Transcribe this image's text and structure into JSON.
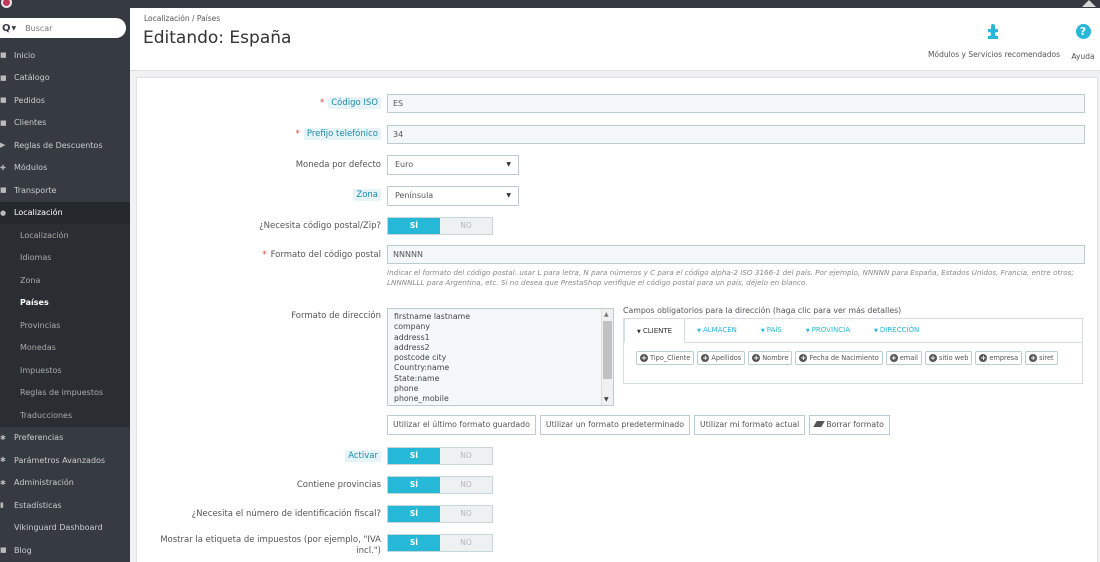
{
  "search": {
    "placeholder": "Buscar"
  },
  "sidebar": {
    "items": [
      {
        "label": "Inicio",
        "icon": "home-icon"
      },
      {
        "label": "Catálogo",
        "icon": "catalog-icon"
      },
      {
        "label": "Pedidos",
        "icon": "orders-icon"
      },
      {
        "label": "Clientes",
        "icon": "customers-icon"
      },
      {
        "label": "Reglas de Descuentos",
        "icon": "discount-icon"
      },
      {
        "label": "Módulos",
        "icon": "modules-icon"
      },
      {
        "label": "Transporte",
        "icon": "truck-icon"
      },
      {
        "label": "Localización",
        "icon": "globe-icon"
      }
    ],
    "subitems": [
      "Localización",
      "Idiomas",
      "Zona",
      "Países",
      "Provincias",
      "Monedas",
      "Impuestos",
      "Reglas de impuestos",
      "Traducciones"
    ],
    "items_after": [
      {
        "label": "Preferencias",
        "icon": "preferences-icon"
      },
      {
        "label": "Parámetros Avanzados",
        "icon": "advanced-icon"
      },
      {
        "label": "Administración",
        "icon": "admin-icon"
      },
      {
        "label": "Estadísticas",
        "icon": "stats-icon"
      },
      {
        "label": "Vikinguard Dashboard",
        "icon": ""
      },
      {
        "label": "Blog",
        "icon": "blog-icon"
      }
    ]
  },
  "header": {
    "breadcrumb": "Localización  /  Países",
    "title": "Editando: España",
    "modules_label": "Módulos y Servicios recomendados",
    "help_label": "Ayuda",
    "help_glyph": "?"
  },
  "form": {
    "iso_label": "Código ISO",
    "iso_value": "ES",
    "prefix_label": "Prefijo telefónico",
    "prefix_value": "34",
    "currency_label": "Moneda por defecto",
    "currency_value": "Euro",
    "zone_label": "Zona",
    "zone_value": "Península",
    "zip_needed_label": "¿Necesita código postal/Zip?",
    "zip_format_label": "Formato del código postal",
    "zip_format_value": "NNNNN",
    "zip_help": "Indicar el formato del código postal: usar L para letra, N para números y C para el código alpha-2 ISO 3166-1 del país. Por ejemplo, NNNNN para España, Estados Unidos, Francia, entre otros; LNNNNLLL para Argentina, etc. Si no desea que PrestaShop verifique el código postal para un país, déjelo en blanco.",
    "address_label": "Formato de dirección",
    "address_lines": [
      "firstname lastname",
      "company",
      "address1",
      "address2",
      "postcode city",
      "Country:name",
      "State:name",
      "phone",
      "phone_mobile"
    ],
    "required_fields_title": "Campos obligatorios para la dirección (haga clic para ver más detalles)",
    "tabs": [
      "CLIENTE",
      "ALMACÉN",
      "PAÍS",
      "PROVINCIA",
      "DIRECCIÓN"
    ],
    "chips": [
      "Tipo_Cliente",
      "Apellidos",
      "Nombre",
      "Fecha de Nacimiento",
      "email",
      "sitio web",
      "empresa",
      "siret"
    ],
    "buttons": {
      "last_saved": "Utilizar el último formato guardado",
      "default": "Utilizar un formato predeterminado",
      "current": "Utilizar mi formato actual",
      "clear": "Borrar formato"
    },
    "active_label": "Activar",
    "states_label": "Contiene provincias",
    "tax_id_label": "¿Necesita el número de identificación fiscal?",
    "tax_label_line1": "Mostrar la etiqueta de impuestos (por ejemplo, \"IVA",
    "tax_label_line2": "incl.\")",
    "yes": "SÍ",
    "no": "NO"
  },
  "colors": {
    "accent": "#25b9d7",
    "sidebar": "#363a41",
    "required": "#e0433c"
  }
}
